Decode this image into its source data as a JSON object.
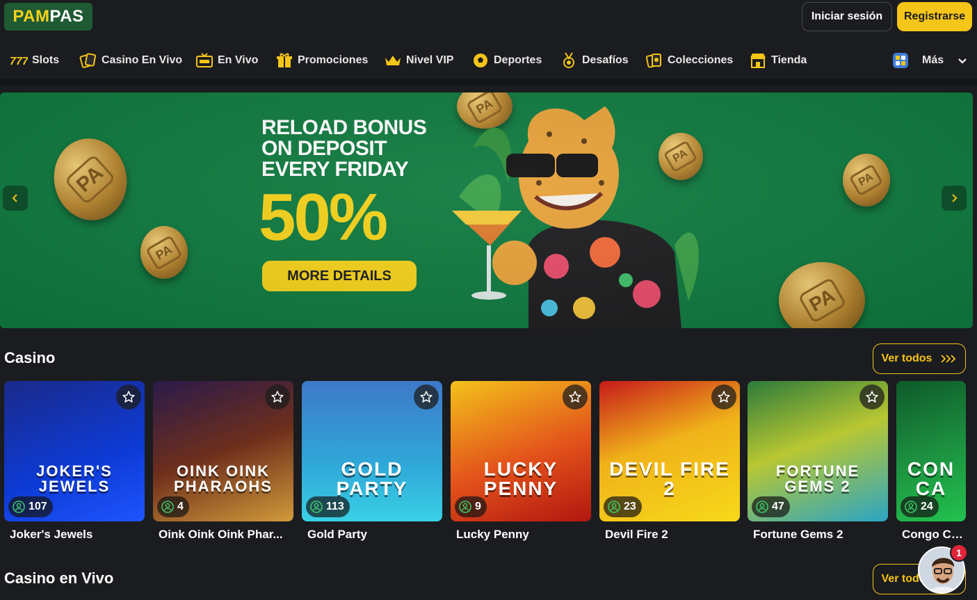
{
  "brand": {
    "logo_part1": "PAM",
    "logo_part2": "PAS"
  },
  "header": {
    "login_label": "Iniciar sesión",
    "register_label": "Registrarse"
  },
  "nav": {
    "items": [
      {
        "label": "Slots",
        "icon": "slots-777-icon"
      },
      {
        "label": "Casino En Vivo",
        "icon": "cards-icon"
      },
      {
        "label": "En Vivo",
        "icon": "tv-icon"
      },
      {
        "label": "Promociones",
        "icon": "gift-icon"
      },
      {
        "label": "Nivel VIP",
        "icon": "crown-icon"
      },
      {
        "label": "Deportes",
        "icon": "soccer-ball-icon"
      },
      {
        "label": "Desafíos",
        "icon": "medal-icon"
      },
      {
        "label": "Colecciones",
        "icon": "collection-cards-icon"
      },
      {
        "label": "Tienda",
        "icon": "shop-icon"
      }
    ],
    "more_label": "Más"
  },
  "banner": {
    "line1": "RELOAD BONUS",
    "line2": "ON DEPOSIT",
    "line3": "EVERY FRIDAY",
    "percent": "50%",
    "cta": "MORE DETAILS",
    "coin_text": "PA",
    "colors": {
      "background": "#0f7a3f",
      "accent": "#f5d21a"
    }
  },
  "casino": {
    "title": "Casino",
    "view_all": "Ver todos",
    "games": [
      {
        "name": "Joker's Jewels",
        "players": "107",
        "art": "JOKER'S JEWELS",
        "bg": "linear-gradient(160deg,#1a2a8a,#0d3bd6 60%,#1f55ff)"
      },
      {
        "name": "Oink Oink Oink Phar...",
        "players": "4",
        "art": "OINK OINK PHARAOHS",
        "bg": "linear-gradient(160deg,#2a1a4a,#6e2f1c 50%,#d19a3a)"
      },
      {
        "name": "Gold Party",
        "players": "113",
        "art": "GOLD PARTY",
        "bg": "linear-gradient(180deg,#3e79c9,#2fa8d8 60%,#39d0e6)"
      },
      {
        "name": "Lucky Penny",
        "players": "9",
        "art": "LUCKY PENNY",
        "bg": "linear-gradient(160deg,#f3c21b,#e3521b 55%,#b0170f)"
      },
      {
        "name": "Devil Fire 2",
        "players": "23",
        "art": "DEVIL FIRE 2",
        "bg": "linear-gradient(160deg,#c61a1a,#f0b31a 45%,#f7d91a)"
      },
      {
        "name": "Fortune Gems 2",
        "players": "47",
        "art": "FORTUNE GEMS 2",
        "bg": "linear-gradient(160deg,#2c7a3a,#b8c732 45%,#2ba5c4)"
      },
      {
        "name": "Congo Casl",
        "players": "24",
        "art": "CON CA",
        "bg": "linear-gradient(160deg,#0e5a2a,#1c8f3f 50%,#22c24e)"
      }
    ]
  },
  "live_casino": {
    "title": "Casino en Vivo",
    "view_all": "Ver todos"
  },
  "chat": {
    "badge": "1"
  }
}
